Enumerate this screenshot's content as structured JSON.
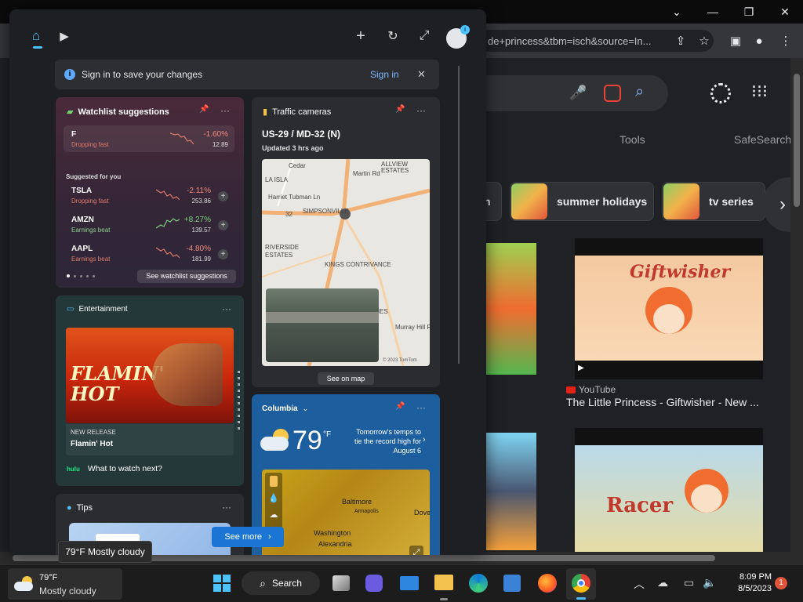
{
  "browser": {
    "url_fragment": "de+princess&tbm=isch&source=In...",
    "nav_tools": "Tools",
    "nav_safesearch": "SafeSearch",
    "chips": [
      {
        "label": "n"
      },
      {
        "label": "summer holidays"
      },
      {
        "label": "tv series"
      }
    ],
    "results": [
      {
        "source": "YouTube",
        "title": "The Little Princess - Giftwisher - New ...",
        "thumb_text": "Giftwisher"
      },
      {
        "thumb_text": "Racer"
      }
    ]
  },
  "widgets": {
    "banner": {
      "text": "Sign in to save your changes",
      "action": "Sign in"
    },
    "watchlist": {
      "title": "Watchlist suggestions",
      "top": {
        "symbol": "F",
        "sub": "Dropping fast",
        "change": "-1.60%",
        "price": "12.89"
      },
      "suggested_label": "Suggested for you",
      "items": [
        {
          "symbol": "TSLA",
          "sub": "Dropping fast",
          "change": "-2.11%",
          "price": "253.86",
          "trend": "neg"
        },
        {
          "symbol": "AMZN",
          "sub": "Earnings beat",
          "change": "+8.27%",
          "price": "139.57",
          "trend": "pos"
        },
        {
          "symbol": "AAPL",
          "sub": "Earnings beat",
          "change": "-4.80%",
          "price": "181.99",
          "trend": "neg"
        }
      ],
      "action": "See watchlist suggestions"
    },
    "traffic": {
      "title": "Traffic cameras",
      "road": "US-29 / MD-32 (N)",
      "updated": "Updated 3 hrs ago",
      "map_labels": [
        "ALLVIEW",
        "ESTATES",
        "LA ISLA",
        "Cedar",
        "Harriet Tubman Ln",
        "Martin Rd",
        "SIMPSONVILLE",
        "32",
        "RIVERSIDE",
        "ESTATES",
        "KINGS CONTRIVANCE",
        "INES",
        "Murray Hill Rd"
      ],
      "copyright": "© 2023 TomTom",
      "action": "See on map"
    },
    "entertainment": {
      "title": "Entertainment",
      "poster_text": "FLAMIN' HOT",
      "badge": "NEW RELEASE",
      "movie": "Flamin' Hot",
      "brand": "hulu",
      "prompt": "What to watch next?"
    },
    "weather": {
      "location": "Columbia",
      "temp": "79",
      "unit": "°F",
      "note": "Tomorrow's temps to tie the record high for August 6",
      "map_labels": [
        "Baltimore",
        "Annapolis",
        "Dove",
        "Washington",
        "Alexandria"
      ]
    },
    "tips": {
      "title": "Tips"
    },
    "see_more": "See more"
  },
  "tooltip": "79°F Mostly cloudy",
  "taskbar": {
    "weather_temp": "79°F",
    "weather_desc": "Mostly cloudy",
    "search_label": "Search",
    "time": "8:09 PM",
    "date": "8/5/2023",
    "notification_count": "1"
  }
}
